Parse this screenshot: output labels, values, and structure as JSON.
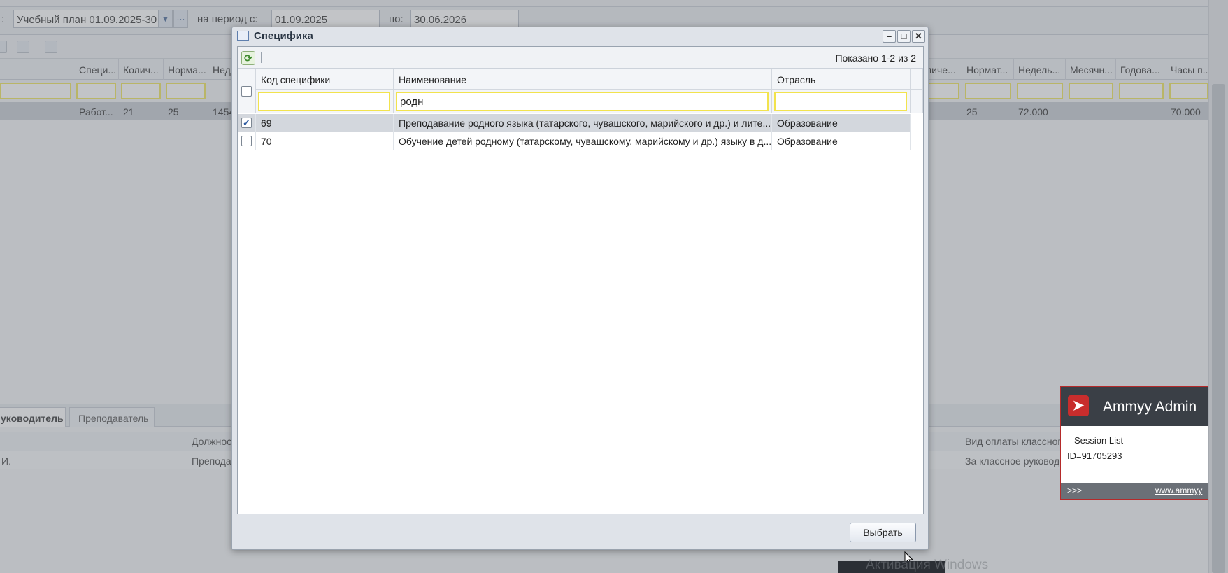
{
  "background": {
    "toolbar": {
      "colon": ":",
      "plan_value": "Учебный план 01.09.2025-30",
      "period_label": "на период с:",
      "period_from": "01.09.2025",
      "period_to_label": "по:",
      "period_to": "30.06.2026"
    },
    "grid_headers_left": [
      "Специ...",
      "Колич...",
      "Норма...",
      "Нед"
    ],
    "grid_headers_right": [
      "личе...",
      "Нормат...",
      "Недель...",
      "Месячн...",
      "Годова...",
      "Часы п..."
    ],
    "row_left": [
      "Работ...",
      "21",
      "25",
      "1454"
    ],
    "row_right": [
      "25",
      "72.000",
      "70.000"
    ],
    "tabs": [
      "уководитель",
      "Преподаватель"
    ],
    "lower_head": {
      "col1": "Должнос",
      "col2": "Вид оплаты классного"
    },
    "lower_row": {
      "col0": "И.",
      "col1": "Препода",
      "col2": "За классное руководс"
    }
  },
  "modal": {
    "title": "Специфика",
    "paging_info": "Показано 1-2 из 2",
    "columns": [
      "Код специфики",
      "Наименование",
      "Отрасль"
    ],
    "filters": {
      "code": "",
      "name": "родн",
      "industry": ""
    },
    "rows": [
      {
        "code": "69",
        "name": "Преподавание родного языка (татарского, чувашского, марийского и др.) и лите...",
        "industry": "Образование",
        "checked": true,
        "selected": true
      },
      {
        "code": "70",
        "name": "Обучение детей родному (татарскому, чувашскому, марийскому и др.) языку в д...",
        "industry": "Образование",
        "checked": false,
        "selected": false
      }
    ],
    "select_button": "Выбрать"
  },
  "ammyy": {
    "title": "Ammyy Admin",
    "session_label": "Session List",
    "id_text": "ID=91705293",
    "footer_arrows": ">>>",
    "footer_link": "www.ammyy"
  },
  "watermark": "Активация Windows",
  "colors": {
    "filter_border": "#f2e34e",
    "selected_row": "#d3d7dd",
    "ammyy_red": "#c82d2d"
  }
}
